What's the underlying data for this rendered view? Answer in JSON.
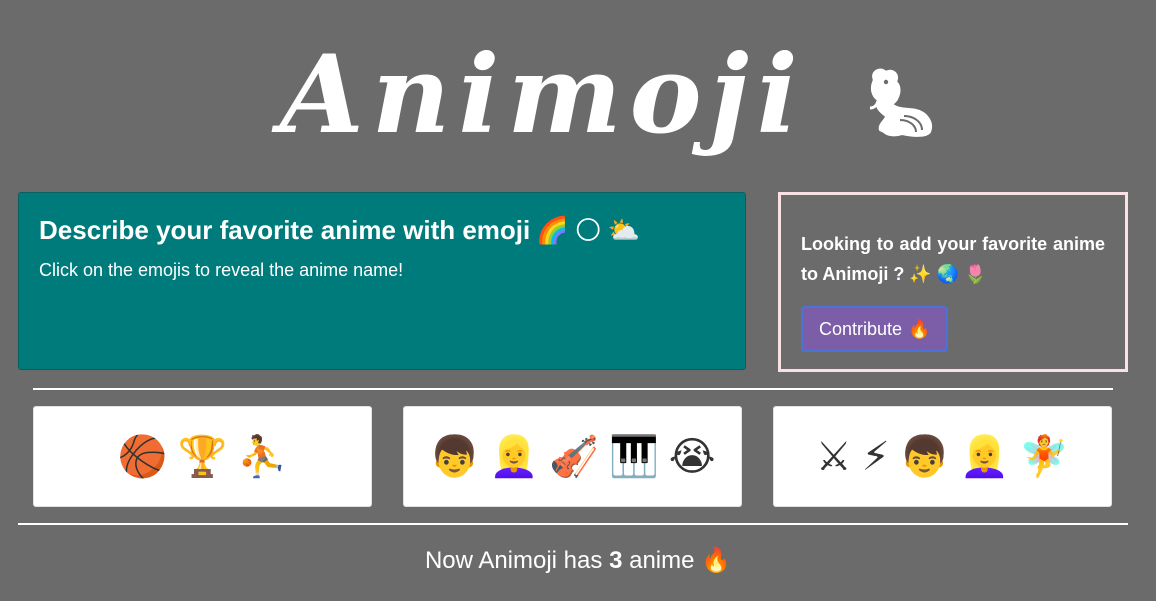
{
  "header": {
    "logo_text": "Animoji",
    "mascot_icon": "chipmunk-icon"
  },
  "intro": {
    "title": "Describe your favorite anime with emoji",
    "title_emojis": [
      "🌈",
      "🌕",
      "⛅"
    ],
    "subtitle": "Click on the emojis to reveal the anime name!"
  },
  "contribute": {
    "text": "Looking to add your favorite anime to Animoji ?",
    "text_emojis": [
      "✨",
      "🌏",
      "🌷"
    ],
    "button_label": "Contribute",
    "button_emoji": "🔥"
  },
  "cards": [
    {
      "emojis": [
        "🏀",
        "🏆",
        "⛹"
      ]
    },
    {
      "emojis": [
        "👦",
        "👱‍♀️",
        "🎻",
        "🎹",
        "😭"
      ]
    },
    {
      "emojis": [
        "⚔",
        "⚡",
        "👦",
        "👱‍♀️",
        "🧚"
      ]
    }
  ],
  "footer": {
    "prefix": "Now Animoji has",
    "count": "3",
    "suffix": "anime",
    "emoji": "🔥"
  },
  "colors": {
    "background": "#6b6b6b",
    "intro_card": "#007b7b",
    "contribute_button": "#7b5ea7",
    "contribute_border": "#f9e1e6"
  }
}
